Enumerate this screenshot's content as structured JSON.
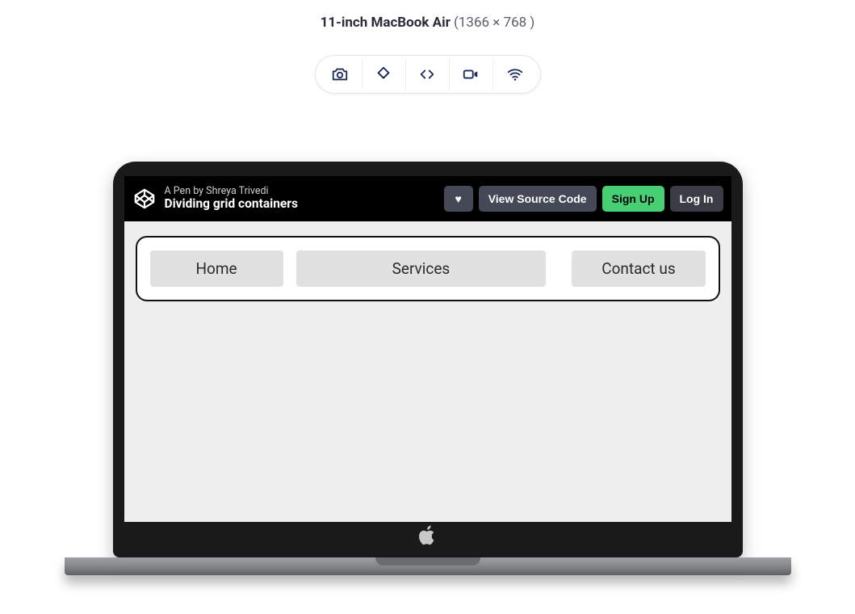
{
  "device": {
    "name": "11-inch MacBook Air",
    "dimensions": "(1366 × 768 )"
  },
  "toolbar": {
    "camera": "camera",
    "rotate": "rotate",
    "code": "code",
    "video": "video",
    "wifi": "wifi"
  },
  "pen": {
    "byline": "A Pen by Shreya Trivedi",
    "title": "Dividing grid containers",
    "heart": "♥",
    "view_source": "View Source Code",
    "signup": "Sign Up",
    "login": "Log In"
  },
  "nav": {
    "items": [
      "Home",
      "Services",
      "Contact us"
    ]
  }
}
